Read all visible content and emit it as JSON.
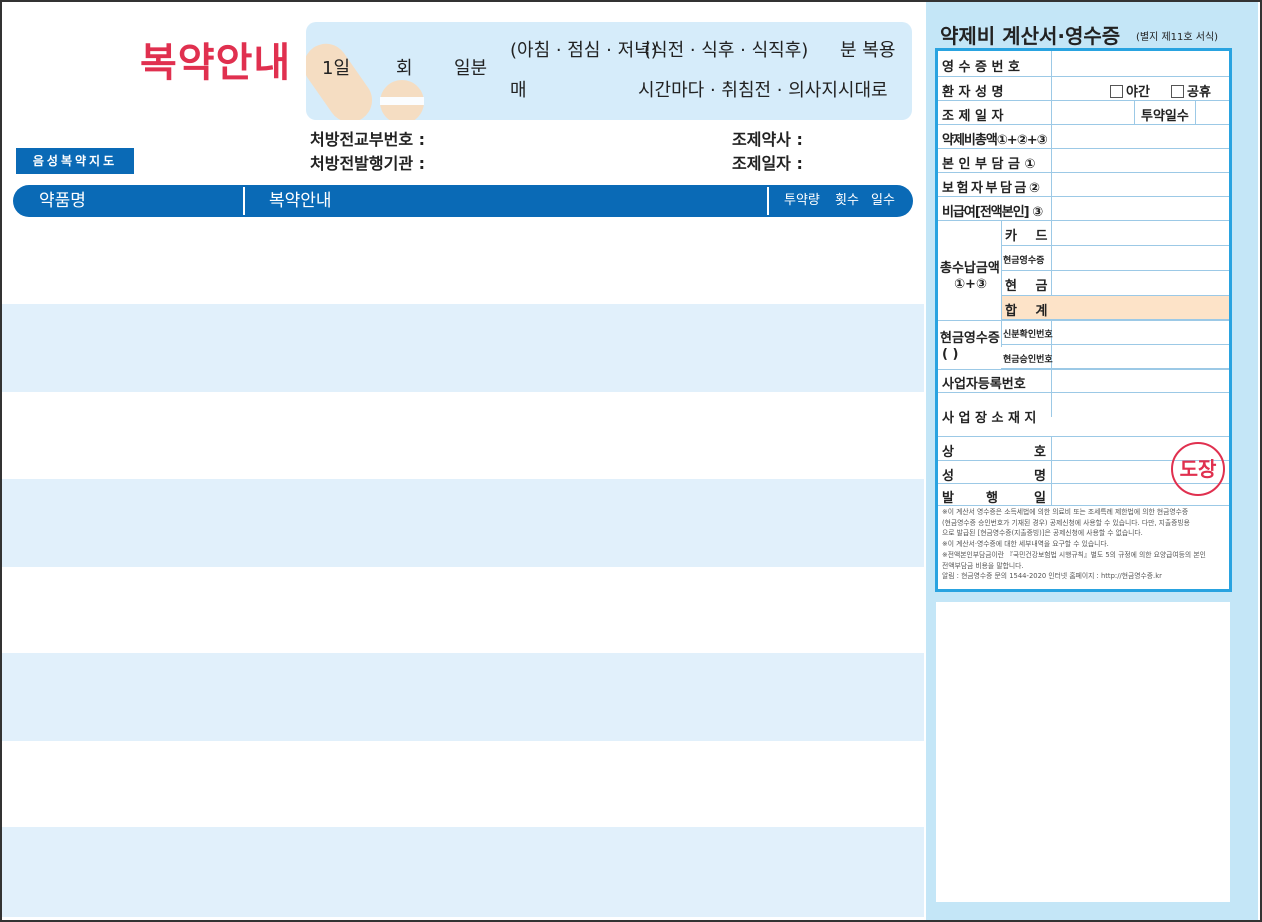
{
  "left": {
    "title": "복약안내",
    "dosage": {
      "day": "1일",
      "times": "회",
      "days": "일분",
      "meals": "(아침 · 점심 · 저녁)",
      "timing": "(식전 · 식후 · 식직후)",
      "minutes": "분 복용",
      "every": "매",
      "others": "시간마다 · 취침전 · 의사지시대로"
    },
    "prescription": {
      "number_label": "처방전교부번호 :",
      "institution_label": "처방전발행기관 :",
      "pharmacist_label": "조제약사 :",
      "date_label": "조제일자 :"
    },
    "voice_button": "음성복약지도",
    "table": {
      "col_drug": "약품명",
      "col_guide": "복약안내",
      "col_dose": "투약량",
      "col_freq": "횟수",
      "col_days": "일수"
    }
  },
  "receipt": {
    "title": "약제비 계산서·영수증",
    "form_ref": "(별지 제11호 서식)",
    "receipt_no": "영 수 증 번 호",
    "patient_name": "환 자 성 명",
    "night": "야간",
    "holiday": "공휴",
    "prep_date": "조 제 일 자",
    "dose_days": "투약일수",
    "total_cost": "약제비총액①+②+③",
    "self_pay": "본 인 부 담 금 ①",
    "insurer_pay": "보 험 자 부 담 금 ②",
    "non_covered": "비급여[전액본인] ③",
    "total_paid": "총수납금액",
    "total_paid_formula": "①+③",
    "card": "카 드",
    "cash_receipt_small": "현금영수증",
    "cash": "현 금",
    "sum": "합 계",
    "cash_receipt": "현금영수증",
    "cash_receipt_paren": "(        )",
    "id_no": "신분확인번호",
    "approval_no": "현금승인번호",
    "business_no": "사업자등록번호",
    "business_addr": "사 업 장 소 재 지",
    "company": "상",
    "company2": "호",
    "name": "성",
    "name2": "명",
    "issuer": "발",
    "issuer2": "행",
    "issuer3": "일",
    "stamp": "도장",
    "notes": [
      "※이 계산서 영수증은 소득세법에 의한 의료비 또는 조세특례 제한법에 의한 현금영수증",
      "  (현금영수증 승인번호가 기재된 경우) 공제신청에 사용할 수 있습니다. 다만, 지출증빙용",
      "  으로 발급된 [현금영수증(지출증빙)]은 공제신청에 사용할 수 없습니다.",
      "※이 계산서·영수증에 대한 세부내역을 요구할 수 있습니다.",
      "※전액본인부담금이란 『국민건강보험법 시행규칙』별도 5의 규정에 의한 요양급여등의 본인",
      "  전액부담금 비용을 말합니다.",
      "  알림 : 현금영수증 문의 1544-2020     인터넷 홈페이지 : http://현금영수증.kr"
    ]
  },
  "colors": {
    "brand_blue": "#0a6ab6",
    "title_red": "#e0304f",
    "band_blue": "#e1f0fb",
    "panel_blue": "#c4e6f7",
    "sum_orange": "#fde3c8"
  }
}
